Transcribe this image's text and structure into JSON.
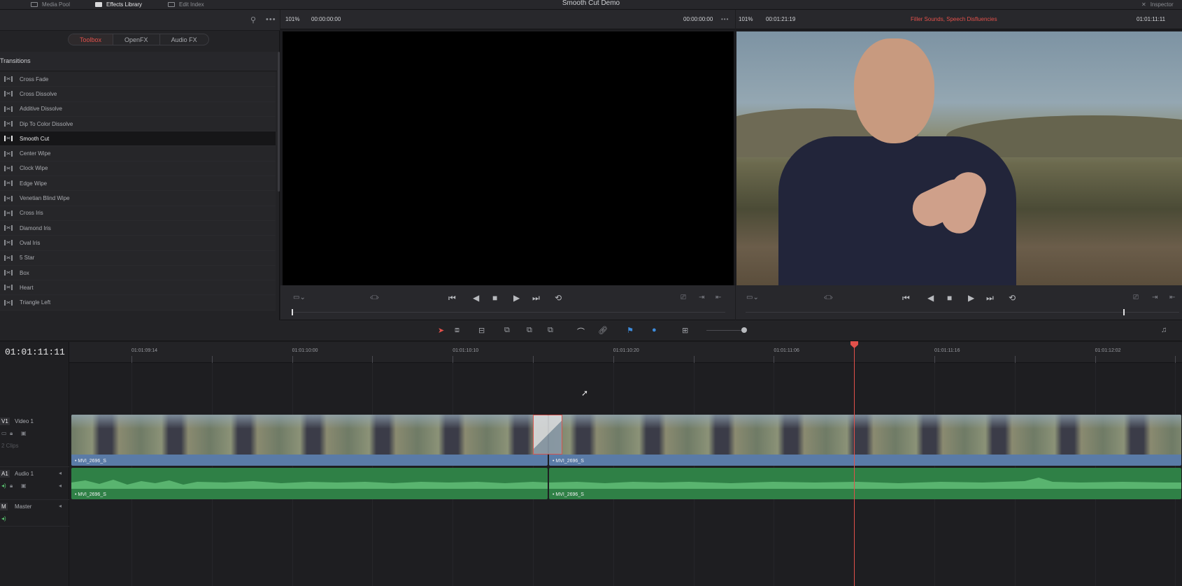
{
  "topbar": {
    "tabs": [
      {
        "label": "Media Pool"
      },
      {
        "label": "Effects Library"
      },
      {
        "label": "Edit Index"
      }
    ],
    "project_title": "Smooth Cut Demo",
    "inspector_label": "Inspector"
  },
  "effects_library": {
    "segment_tabs": [
      "Toolbox",
      "OpenFX",
      "Audio FX"
    ],
    "active_segment": "Toolbox",
    "section_title": "Transitions",
    "items": [
      "Cross Fade",
      "Cross Dissolve",
      "Additive Dissolve",
      "Dip To Color Dissolve",
      "Smooth Cut",
      "Center Wipe",
      "Clock Wipe",
      "Edge Wipe",
      "Venetian Blind Wipe",
      "Cross Iris",
      "Diamond Iris",
      "Oval Iris",
      "5 Star",
      "Box",
      "Heart",
      "Triangle Left"
    ],
    "selected_item": "Smooth Cut"
  },
  "source_viewer": {
    "zoom": "101%",
    "timecode_left": "00:00:00:00",
    "timecode_right": "00:00:00:00"
  },
  "timeline_viewer": {
    "zoom": "101%",
    "timecode_left": "00:01:21:19",
    "clip_name": "Filler Sounds, Speech Disfluencies",
    "timecode_right": "01:01:11:11"
  },
  "timeline": {
    "timecode": "01:01:11:11",
    "ruler_labels": [
      "01:01:09:14",
      "01:01:10:00",
      "01:01:10:10",
      "01:01:10:20",
      "01:01:11:06",
      "01:01:11:16",
      "01:01:12:02"
    ],
    "tracks": {
      "video": {
        "badge": "V1",
        "name": "Video 1",
        "clip_count": "2 Clips"
      },
      "audio": {
        "badge": "A1",
        "name": "Audio 1"
      },
      "master": {
        "badge": "M",
        "name": "Master"
      }
    },
    "video_clips": [
      {
        "label": "• MVI_2696_S"
      },
      {
        "label": "• MVI_2696_S"
      }
    ],
    "audio_clips": [
      {
        "label": "• MVI_2696_S"
      },
      {
        "label": "• MVI_2696_S"
      }
    ],
    "transition": "Smooth Cut"
  },
  "colors": {
    "accent_red": "#e2514b",
    "video_clip": "#5a7ba7",
    "audio_clip": "#2f8046"
  }
}
